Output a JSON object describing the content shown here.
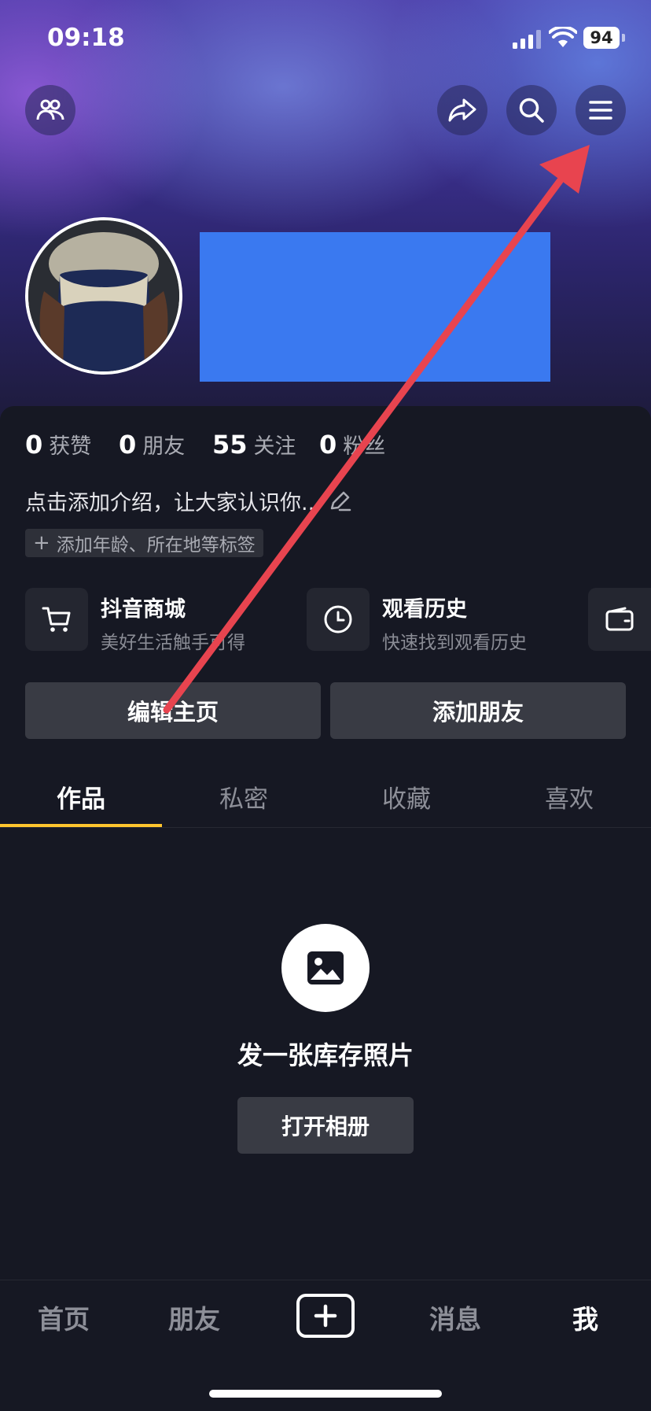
{
  "status_bar": {
    "time": "09:18",
    "battery": "94"
  },
  "profile": {
    "stats": [
      {
        "value": "0",
        "label": "获赞"
      },
      {
        "value": "0",
        "label": "朋友"
      },
      {
        "value": "55",
        "label": "关注"
      },
      {
        "value": "0",
        "label": "粉丝"
      }
    ],
    "bio_placeholder": "点击添加介绍，让大家认识你...",
    "tag_hint": "添加年龄、所在地等标签"
  },
  "services": [
    {
      "title": "抖音商城",
      "subtitle": "美好生活触手可得",
      "icon": "cart-icon"
    },
    {
      "title": "观看历史",
      "subtitle": "快速找到观看历史",
      "icon": "clock-icon"
    },
    {
      "icon": "wallet-icon"
    }
  ],
  "actions": {
    "edit_label": "编辑主页",
    "add_friend_label": "添加朋友"
  },
  "tabs": [
    "作品",
    "私密",
    "收藏",
    "喜欢"
  ],
  "empty_state": {
    "title": "发一张库存照片",
    "button_label": "打开相册"
  },
  "bottom_nav": {
    "home": "首页",
    "friends": "朋友",
    "messages": "消息",
    "me": "我"
  },
  "colors": {
    "accent": "#fec52e",
    "annotation_arrow": "#e8444f",
    "redaction": "#3a79f0"
  }
}
